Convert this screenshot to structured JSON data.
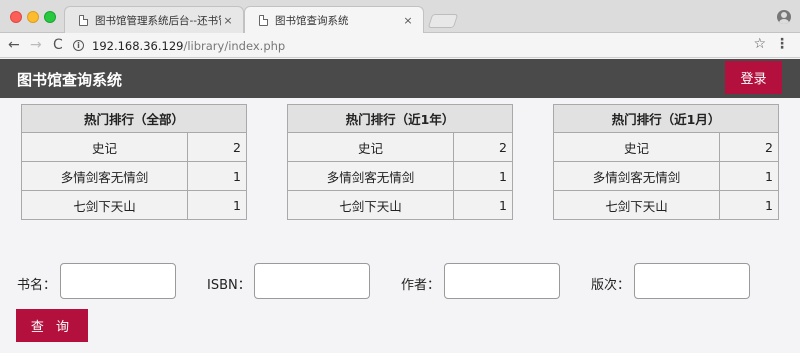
{
  "browser": {
    "tabs": [
      {
        "title": "图书馆管理系统后台--还书管理",
        "close": "×"
      },
      {
        "title": "图书馆查询系统",
        "close": "×"
      }
    ],
    "nav": {
      "back": "←",
      "forward": "→",
      "reload": "C"
    },
    "url_host": "192.168.36.129",
    "url_path": "/library/index.php",
    "bookmark_icon": "☆",
    "menu_icon": "⋮"
  },
  "header": {
    "title": "图书馆查询系统",
    "login_label": "登录"
  },
  "rankings": [
    {
      "title": "热门排行（全部）",
      "rows": [
        {
          "name": "史记",
          "count": "2"
        },
        {
          "name": "多情剑客无情剑",
          "count": "1"
        },
        {
          "name": "七剑下天山",
          "count": "1"
        }
      ]
    },
    {
      "title": "热门排行（近1年）",
      "rows": [
        {
          "name": "史记",
          "count": "2"
        },
        {
          "name": "多情剑客无情剑",
          "count": "1"
        },
        {
          "name": "七剑下天山",
          "count": "1"
        }
      ]
    },
    {
      "title": "热门排行（近1月）",
      "rows": [
        {
          "name": "史记",
          "count": "2"
        },
        {
          "name": "多情剑客无情剑",
          "count": "1"
        },
        {
          "name": "七剑下天山",
          "count": "1"
        }
      ]
    }
  ],
  "search": {
    "fields": [
      {
        "label": "书名：",
        "value": ""
      },
      {
        "label": "ISBN：",
        "value": ""
      },
      {
        "label": "作者：",
        "value": ""
      },
      {
        "label": "版次：",
        "value": ""
      }
    ],
    "submit_label": "查 询"
  },
  "colors": {
    "accent": "#b3103d",
    "header_bg": "#4a4a4b"
  }
}
